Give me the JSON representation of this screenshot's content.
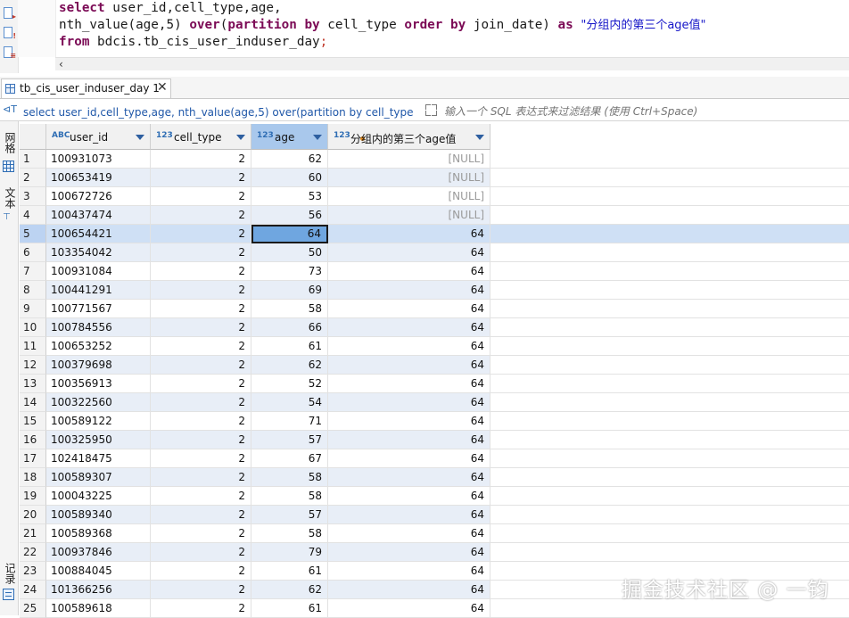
{
  "editor": {
    "line1": {
      "kw": "select",
      "rest": " user_id,cell_type,age,"
    },
    "line2": {
      "fn": "nth_value(age,5) ",
      "over": "over",
      "p1": "(",
      "partition": "partition",
      "sp1": " ",
      "by1": "by",
      "mid": " cell_type ",
      "order": "order",
      "sp2": " ",
      "by2": "by",
      "tail": " join_date) ",
      "as": "as",
      "sp3": " ",
      "alias": "\"分组内的第三个age值\""
    },
    "line3": {
      "kw": "from",
      "rest": " bdcis.tb_cis_user_induser_day",
      "semi": ";"
    },
    "scroll_left": "‹"
  },
  "tab": {
    "label": "tb_cis_user_induser_day 1",
    "close": "✕"
  },
  "filter": {
    "icon": "⊲T",
    "query": "select user_id,cell_type,age, nth_value(age,5) over(partition by cell_type order by join_date) as \"分组内的第三个age值\" from bdcis.tb_cis_user_induser_day",
    "placeholder": "输入一个 SQL 表达式来过滤结果 (使用 Ctrl+Space)"
  },
  "side": {
    "grid_label": "网格",
    "text_label": "文本",
    "record_label": "记录"
  },
  "columns": [
    {
      "type": "ABC",
      "name": "user_id"
    },
    {
      "type": "123",
      "name": "cell_type"
    },
    {
      "type": "123",
      "name": "age"
    },
    {
      "type": "123",
      "name": "分组内的第三个age值"
    }
  ],
  "rows": [
    {
      "rn": "1",
      "uid": "100931073",
      "ct": "2",
      "age": "62",
      "nth": "[NULL]"
    },
    {
      "rn": "2",
      "uid": "100653419",
      "ct": "2",
      "age": "60",
      "nth": "[NULL]"
    },
    {
      "rn": "3",
      "uid": "100672726",
      "ct": "2",
      "age": "53",
      "nth": "[NULL]"
    },
    {
      "rn": "4",
      "uid": "100437474",
      "ct": "2",
      "age": "56",
      "nth": "[NULL]"
    },
    {
      "rn": "5",
      "uid": "100654421",
      "ct": "2",
      "age": "64",
      "nth": "64"
    },
    {
      "rn": "6",
      "uid": "103354042",
      "ct": "2",
      "age": "50",
      "nth": "64"
    },
    {
      "rn": "7",
      "uid": "100931084",
      "ct": "2",
      "age": "73",
      "nth": "64"
    },
    {
      "rn": "8",
      "uid": "100441291",
      "ct": "2",
      "age": "69",
      "nth": "64"
    },
    {
      "rn": "9",
      "uid": "100771567",
      "ct": "2",
      "age": "58",
      "nth": "64"
    },
    {
      "rn": "10",
      "uid": "100784556",
      "ct": "2",
      "age": "66",
      "nth": "64"
    },
    {
      "rn": "11",
      "uid": "100653252",
      "ct": "2",
      "age": "61",
      "nth": "64"
    },
    {
      "rn": "12",
      "uid": "100379698",
      "ct": "2",
      "age": "62",
      "nth": "64"
    },
    {
      "rn": "13",
      "uid": "100356913",
      "ct": "2",
      "age": "52",
      "nth": "64"
    },
    {
      "rn": "14",
      "uid": "100322560",
      "ct": "2",
      "age": "54",
      "nth": "64"
    },
    {
      "rn": "15",
      "uid": "100589122",
      "ct": "2",
      "age": "71",
      "nth": "64"
    },
    {
      "rn": "16",
      "uid": "100325950",
      "ct": "2",
      "age": "57",
      "nth": "64"
    },
    {
      "rn": "17",
      "uid": "102418475",
      "ct": "2",
      "age": "67",
      "nth": "64"
    },
    {
      "rn": "18",
      "uid": "100589307",
      "ct": "2",
      "age": "58",
      "nth": "64"
    },
    {
      "rn": "19",
      "uid": "100043225",
      "ct": "2",
      "age": "58",
      "nth": "64"
    },
    {
      "rn": "20",
      "uid": "100589340",
      "ct": "2",
      "age": "57",
      "nth": "64"
    },
    {
      "rn": "21",
      "uid": "100589368",
      "ct": "2",
      "age": "58",
      "nth": "64"
    },
    {
      "rn": "22",
      "uid": "100937846",
      "ct": "2",
      "age": "79",
      "nth": "64"
    },
    {
      "rn": "23",
      "uid": "100884045",
      "ct": "2",
      "age": "61",
      "nth": "64"
    },
    {
      "rn": "24",
      "uid": "101366256",
      "ct": "2",
      "age": "62",
      "nth": "64"
    },
    {
      "rn": "25",
      "uid": "100589618",
      "ct": "2",
      "age": "61",
      "nth": "64"
    }
  ],
  "selected_row": "5",
  "colors": {
    "accent": "#2e6db4",
    "selected_cell": "#6fa6e0",
    "stripe": "#e8eef7",
    "keyword": "#7b0a55",
    "string": "#1515c8"
  },
  "icons": {
    "tab": "table-icon",
    "filter": "filter-icon",
    "expand": "expand-icon",
    "sort": "sort-down-icon",
    "close": "close-icon"
  },
  "watermark": "掘金技术社区 @ 一钧"
}
